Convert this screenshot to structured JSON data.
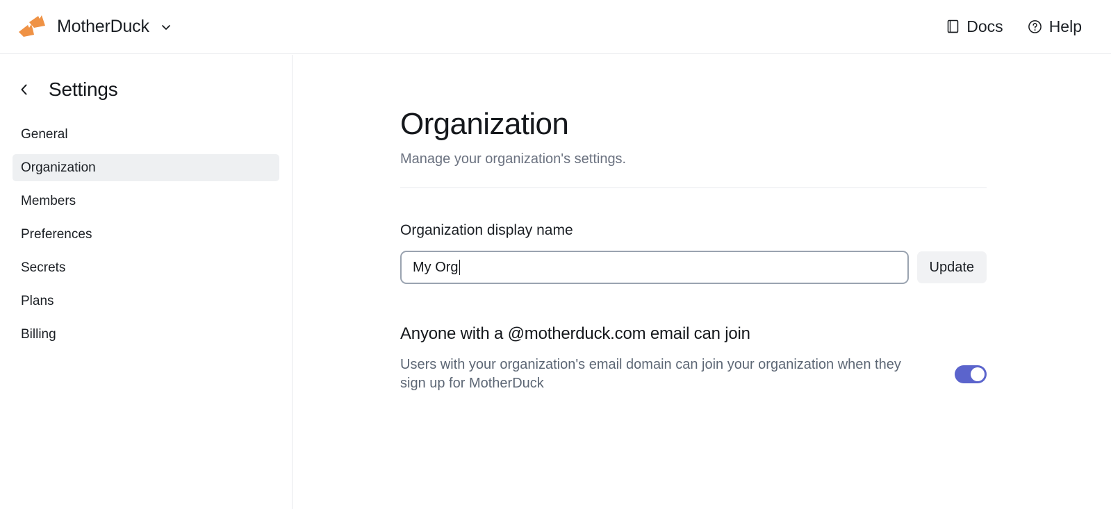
{
  "topbar": {
    "logo_icon": "motherduck-duck-feet-logo",
    "logo_color": "#ef9245",
    "brand_name": "MotherDuck",
    "brand_chevron_icon": "chevron-down-icon",
    "links": [
      {
        "label": "Docs",
        "icon": "book-icon"
      },
      {
        "label": "Help",
        "icon": "question-circle-icon"
      }
    ]
  },
  "sidebar": {
    "back_icon": "chevron-left-icon",
    "title": "Settings",
    "items": [
      {
        "label": "General",
        "selected": false
      },
      {
        "label": "Organization",
        "selected": true
      },
      {
        "label": "Members",
        "selected": false
      },
      {
        "label": "Preferences",
        "selected": false
      },
      {
        "label": "Secrets",
        "selected": false
      },
      {
        "label": "Plans",
        "selected": false
      },
      {
        "label": "Billing",
        "selected": false
      }
    ],
    "selected_bg": "#eef0f2"
  },
  "main": {
    "title": "Organization",
    "subtitle": "Manage your organization's settings.",
    "display_name": {
      "label": "Organization display name",
      "value": "My Org",
      "placeholder": "Organization display name",
      "focused": true,
      "update_label": "Update"
    },
    "domain_join": {
      "title": "Anyone with a @motherduck.com email can join",
      "description": "Users with your organization's email domain can join your organization when they sign up for MotherDuck",
      "toggle_on": true,
      "toggle_color": "#5b64cc"
    }
  }
}
